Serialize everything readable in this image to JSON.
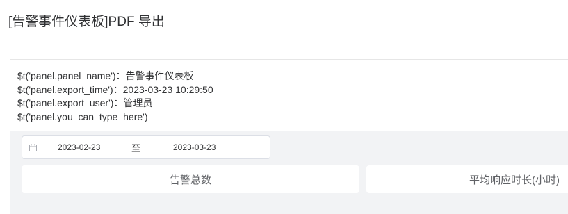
{
  "page": {
    "title": "[告警事件仪表板]PDF 导出"
  },
  "panel": {
    "meta": [
      "$t('panel.panel_name')：告警事件仪表板",
      "$t('panel.export_time')：2023-03-23 10:29:50",
      "$t('panel.export_user')：管理员",
      "$t('panel.you_can_type_here')"
    ]
  },
  "filter": {
    "icon": "calendar-icon",
    "start_date": "2023-02-23",
    "separator": "至",
    "end_date": "2023-03-23"
  },
  "cards": [
    {
      "title": "告警总数"
    },
    {
      "title": "平均响应时长(小时)"
    }
  ],
  "colors": {
    "canvas_bg": "#f2f3f5",
    "border": "#e6e6e6",
    "text": "#303133"
  }
}
